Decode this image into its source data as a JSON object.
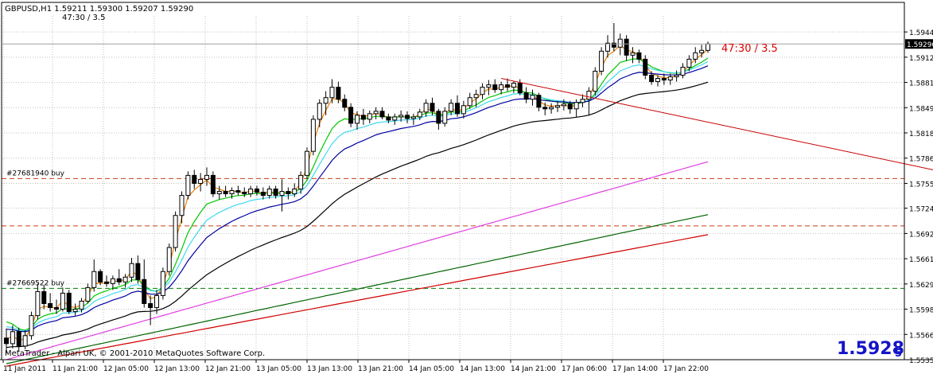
{
  "header": {
    "symbol_line": "GBPUSD,H1  1.59211 1.59300 1.59207 1.59290",
    "sub_line": "47:30 / 3.5"
  },
  "annotation_text": "47:30 / 3.5",
  "copyright": "MetaTrader - Alpari UK, © 2001-2010 MetaQuotes Software Corp.",
  "big_price": {
    "main": "1.5928",
    "sub": "5"
  },
  "current_price_label": "1.59290",
  "order_labels": [
    "#27681940 buy",
    "#27669522 buy"
  ],
  "colors": {
    "bg": "#ffffff",
    "grid": "#c0c0c0",
    "candle": "#000000",
    "ema_orange": "#e6820a",
    "ema_green": "#00c800",
    "ema_cyan": "#40d8f0",
    "ema_navy": "#0000a0",
    "ema_black": "#000000",
    "ema_magenta": "#e040e0",
    "ema_darkgreen": "#006400",
    "ema_red": "#d00000",
    "trendline": "#c80000",
    "order_line": "#c83c14",
    "order_line2": "#008000",
    "annotation": "#e00000",
    "big_price": "#1414c8"
  },
  "chart_data": {
    "type": "candlestick",
    "symbol": "GBPUSD",
    "timeframe": "H1",
    "y_ticks": [
      "1.59440",
      "1.59125",
      "1.58810",
      "1.58495",
      "1.58180",
      "1.57865",
      "1.57550",
      "1.57240",
      "1.56925",
      "1.56610",
      "1.56295",
      "1.55980",
      "1.55665",
      "1.55350"
    ],
    "ylim": [
      1.5535,
      1.5964
    ],
    "x_ticks": [
      "11 Jan 2011",
      "11 Jan 21:00",
      "12 Jan 05:00",
      "12 Jan 13:00",
      "12 Jan 21:00",
      "13 Jan 05:00",
      "13 Jan 13:00",
      "13 Jan 21:00",
      "14 Jan 05:00",
      "14 Jan 13:00",
      "14 Jan 21:00",
      "17 Jan 06:00",
      "17 Jan 14:00",
      "17 Jan 22:00"
    ],
    "candles": [
      [
        1.5562,
        1.5574,
        1.5543,
        1.5555
      ],
      [
        1.5555,
        1.5578,
        1.5549,
        1.557
      ],
      [
        1.557,
        1.5575,
        1.5545,
        1.5552
      ],
      [
        1.5552,
        1.5572,
        1.5548,
        1.5565
      ],
      [
        1.5565,
        1.5595,
        1.556,
        1.559
      ],
      [
        1.559,
        1.563,
        1.5585,
        1.562
      ],
      [
        1.562,
        1.5628,
        1.5598,
        1.5605
      ],
      [
        1.5605,
        1.5618,
        1.5595,
        1.56
      ],
      [
        1.56,
        1.561,
        1.5592,
        1.5598
      ],
      [
        1.5598,
        1.5625,
        1.5595,
        1.5618
      ],
      [
        1.5618,
        1.5622,
        1.5592,
        1.5595
      ],
      [
        1.5595,
        1.5605,
        1.559,
        1.5598
      ],
      [
        1.5598,
        1.5612,
        1.5594,
        1.5608
      ],
      [
        1.5608,
        1.563,
        1.5605,
        1.5625
      ],
      [
        1.5625,
        1.566,
        1.562,
        1.5645
      ],
      [
        1.5645,
        1.5648,
        1.5628,
        1.5632
      ],
      [
        1.5632,
        1.564,
        1.5626,
        1.563
      ],
      [
        1.563,
        1.564,
        1.5622,
        1.5636
      ],
      [
        1.5636,
        1.5648,
        1.5628,
        1.5632
      ],
      [
        1.5632,
        1.5642,
        1.5625,
        1.5638
      ],
      [
        1.5638,
        1.5662,
        1.5632,
        1.5655
      ],
      [
        1.5655,
        1.5665,
        1.563,
        1.5635
      ],
      [
        1.5635,
        1.566,
        1.56,
        1.5605
      ],
      [
        1.5605,
        1.5615,
        1.5578,
        1.56
      ],
      [
        1.56,
        1.5622,
        1.5592,
        1.5615
      ],
      [
        1.5615,
        1.565,
        1.561,
        1.5645
      ],
      [
        1.5645,
        1.568,
        1.564,
        1.5675
      ],
      [
        1.5675,
        1.572,
        1.567,
        1.5715
      ],
      [
        1.5715,
        1.5745,
        1.5705,
        1.574
      ],
      [
        1.574,
        1.577,
        1.5735,
        1.5765
      ],
      [
        1.5765,
        1.5772,
        1.5748,
        1.5755
      ],
      [
        1.5755,
        1.5768,
        1.5745,
        1.576
      ],
      [
        1.576,
        1.5775,
        1.5752,
        1.5765
      ],
      [
        1.5765,
        1.577,
        1.5738,
        1.5742
      ],
      [
        1.5742,
        1.5752,
        1.5735,
        1.5745
      ],
      [
        1.5745,
        1.5752,
        1.5738,
        1.5742
      ],
      [
        1.5742,
        1.575,
        1.5736,
        1.5746
      ],
      [
        1.5746,
        1.5752,
        1.574,
        1.5744
      ],
      [
        1.5744,
        1.575,
        1.5738,
        1.5742
      ],
      [
        1.5742,
        1.5752,
        1.5738,
        1.5748
      ],
      [
        1.5748,
        1.5752,
        1.574,
        1.5744
      ],
      [
        1.5744,
        1.575,
        1.5735,
        1.574
      ],
      [
        1.574,
        1.5752,
        1.5736,
        1.5748
      ],
      [
        1.5748,
        1.5752,
        1.5736,
        1.574
      ],
      [
        1.574,
        1.576,
        1.572,
        1.5745
      ],
      [
        1.5745,
        1.575,
        1.5735,
        1.5742
      ],
      [
        1.5742,
        1.5755,
        1.5738,
        1.5748
      ],
      [
        1.5748,
        1.577,
        1.5742,
        1.5765
      ],
      [
        1.5765,
        1.58,
        1.576,
        1.5795
      ],
      [
        1.5795,
        1.584,
        1.579,
        1.5835
      ],
      [
        1.5835,
        1.586,
        1.5825,
        1.5855
      ],
      [
        1.5855,
        1.587,
        1.584,
        1.5862
      ],
      [
        1.5862,
        1.5885,
        1.5855,
        1.5875
      ],
      [
        1.5875,
        1.5882,
        1.5855,
        1.586
      ],
      [
        1.586,
        1.5866,
        1.5845,
        1.585
      ],
      [
        1.585,
        1.5855,
        1.5825,
        1.583
      ],
      [
        1.583,
        1.5845,
        1.5822,
        1.584
      ],
      [
        1.584,
        1.5848,
        1.5828,
        1.5835
      ],
      [
        1.5835,
        1.5846,
        1.583,
        1.5842
      ],
      [
        1.5842,
        1.585,
        1.5835,
        1.5845
      ],
      [
        1.5845,
        1.585,
        1.5835,
        1.5838
      ],
      [
        1.5838,
        1.5842,
        1.583,
        1.5834
      ],
      [
        1.5834,
        1.5842,
        1.5828,
        1.5838
      ],
      [
        1.5838,
        1.5846,
        1.5832,
        1.584
      ],
      [
        1.584,
        1.5845,
        1.583,
        1.5836
      ],
      [
        1.5836,
        1.5842,
        1.5828,
        1.5838
      ],
      [
        1.5838,
        1.5848,
        1.5834,
        1.5844
      ],
      [
        1.5844,
        1.586,
        1.5838,
        1.5855
      ],
      [
        1.5855,
        1.5862,
        1.584,
        1.5845
      ],
      [
        1.5845,
        1.5848,
        1.5822,
        1.583
      ],
      [
        1.583,
        1.585,
        1.5826,
        1.5845
      ],
      [
        1.5845,
        1.586,
        1.584,
        1.5855
      ],
      [
        1.5855,
        1.5865,
        1.5838,
        1.5842
      ],
      [
        1.5842,
        1.5858,
        1.5836,
        1.5852
      ],
      [
        1.5852,
        1.5868,
        1.5848,
        1.5862
      ],
      [
        1.5862,
        1.5872,
        1.585,
        1.5866
      ],
      [
        1.5866,
        1.588,
        1.586,
        1.5875
      ],
      [
        1.5875,
        1.5884,
        1.5865,
        1.5878
      ],
      [
        1.5878,
        1.5885,
        1.5868,
        1.5872
      ],
      [
        1.5872,
        1.5882,
        1.5866,
        1.5878
      ],
      [
        1.5878,
        1.5886,
        1.587,
        1.5875
      ],
      [
        1.5875,
        1.5882,
        1.5868,
        1.588
      ],
      [
        1.588,
        1.5885,
        1.5865,
        1.5868
      ],
      [
        1.5868,
        1.5875,
        1.5855,
        1.586
      ],
      [
        1.586,
        1.5872,
        1.5852,
        1.5865
      ],
      [
        1.5865,
        1.5868,
        1.5845,
        1.585
      ],
      [
        1.585,
        1.5856,
        1.584,
        1.5848
      ],
      [
        1.5848,
        1.5855,
        1.5842,
        1.585
      ],
      [
        1.585,
        1.5858,
        1.5844,
        1.5852
      ],
      [
        1.5852,
        1.586,
        1.5846,
        1.5854
      ],
      [
        1.5854,
        1.5858,
        1.5842,
        1.5848
      ],
      [
        1.5848,
        1.586,
        1.5838,
        1.5856
      ],
      [
        1.5856,
        1.5866,
        1.585,
        1.586
      ],
      [
        1.586,
        1.5875,
        1.584,
        1.587
      ],
      [
        1.587,
        1.59,
        1.5865,
        1.5895
      ],
      [
        1.5895,
        1.5925,
        1.589,
        1.592
      ],
      [
        1.592,
        1.594,
        1.5912,
        1.593
      ],
      [
        1.593,
        1.5955,
        1.592,
        1.5925
      ],
      [
        1.5925,
        1.5942,
        1.5915,
        1.5935
      ],
      [
        1.5935,
        1.594,
        1.5908,
        1.5915
      ],
      [
        1.5915,
        1.5925,
        1.5905,
        1.5918
      ],
      [
        1.5918,
        1.5922,
        1.5905,
        1.591
      ],
      [
        1.591,
        1.5915,
        1.5885,
        1.589
      ],
      [
        1.589,
        1.5895,
        1.5878,
        1.5882
      ],
      [
        1.5882,
        1.589,
        1.5876,
        1.5886
      ],
      [
        1.5886,
        1.5892,
        1.5878,
        1.5884
      ],
      [
        1.5884,
        1.5892,
        1.5878,
        1.5888
      ],
      [
        1.5888,
        1.5896,
        1.5882,
        1.589
      ],
      [
        1.589,
        1.5905,
        1.5886,
        1.59
      ],
      [
        1.59,
        1.5915,
        1.5895,
        1.591
      ],
      [
        1.591,
        1.5925,
        1.5905,
        1.5918
      ],
      [
        1.5918,
        1.5928,
        1.5912,
        1.5921
      ],
      [
        1.5921,
        1.5932,
        1.5918,
        1.5929
      ]
    ],
    "moving_averages": [
      {
        "color": "orange",
        "start": 1.5565,
        "end": 1.5915
      },
      {
        "color": "green",
        "start": 1.559,
        "end": 1.5905
      },
      {
        "color": "cyan",
        "start": 1.558,
        "end": 1.5895
      },
      {
        "color": "navy",
        "start": 1.5575,
        "end": 1.5888
      },
      {
        "color": "black",
        "start": 1.555,
        "end": 1.5853
      },
      {
        "color": "magenta",
        "start": 1.5535,
        "end": 1.5782
      },
      {
        "color": "darkgreen",
        "start": 1.553,
        "end": 1.5716
      },
      {
        "color": "red",
        "start": 1.5527,
        "end": 1.5691
      }
    ],
    "order_levels": [
      {
        "label": "#27681940 buy",
        "price": 1.5761
      },
      {
        "label": "#27669522 buy",
        "price": 1.5624
      }
    ],
    "dashed_level": 1.5702,
    "trendline": {
      "from": [
        1.5886
      ],
      "to": [
        1.5772
      ]
    },
    "current_price": 1.5929
  }
}
